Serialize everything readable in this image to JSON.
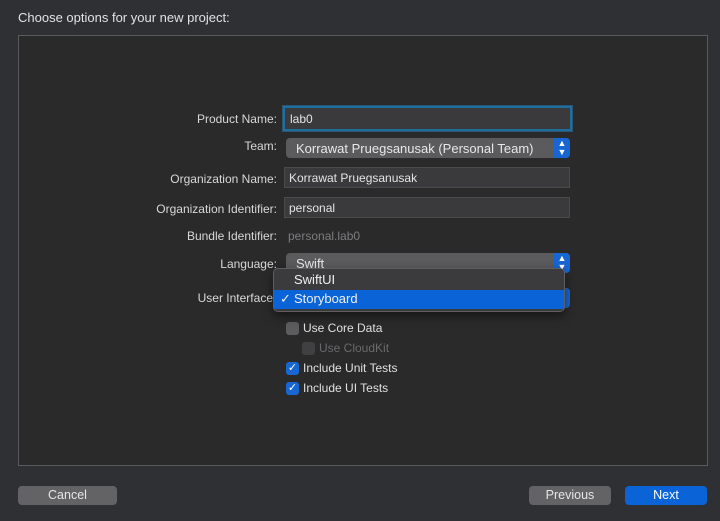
{
  "header": {
    "title": "Choose options for your new project:"
  },
  "form": {
    "product_name": {
      "label": "Product Name:",
      "value": "lab0"
    },
    "team": {
      "label": "Team:",
      "value": "Korrawat Pruegsanusak (Personal Team)"
    },
    "organization_name": {
      "label": "Organization Name:",
      "value": "Korrawat Pruegsanusak"
    },
    "organization_identifier": {
      "label": "Organization Identifier:",
      "value": "personal"
    },
    "bundle_identifier": {
      "label": "Bundle Identifier:",
      "value": "personal.lab0"
    },
    "language": {
      "label": "Language:",
      "value": "Swift"
    },
    "user_interface": {
      "label": "User Interface",
      "options": [
        "SwiftUI",
        "Storyboard"
      ],
      "selected": "Storyboard",
      "check": "✓"
    },
    "checkboxes": [
      {
        "label": "Use Core Data",
        "checked": false,
        "enabled": true
      },
      {
        "label": "Use CloudKit",
        "checked": false,
        "enabled": false
      },
      {
        "label": "Include Unit Tests",
        "checked": true,
        "enabled": true
      },
      {
        "label": "Include UI Tests",
        "checked": true,
        "enabled": true
      }
    ]
  },
  "footer": {
    "cancel": "Cancel",
    "previous": "Previous",
    "next": "Next"
  },
  "colors": {
    "accent": "#0a64d8",
    "background": "#2f3033"
  }
}
